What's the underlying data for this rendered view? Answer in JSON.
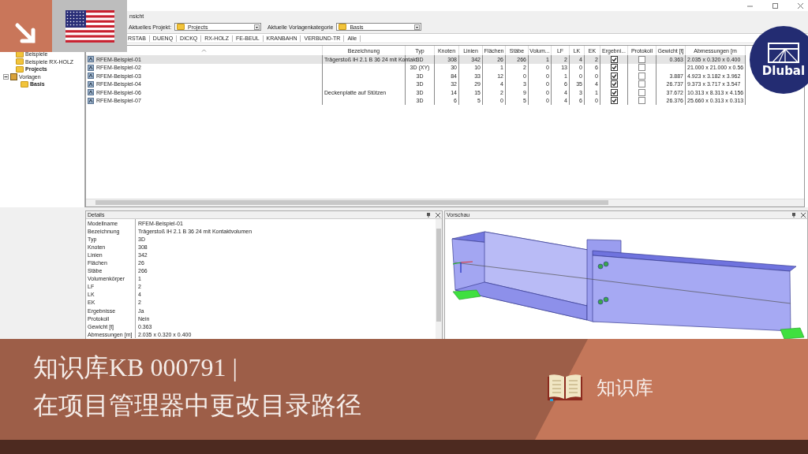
{
  "window": {
    "header_fragment": "nsicht"
  },
  "toolbar": {
    "project_label": "Aktuelles Projekt:",
    "project_value": "Projects",
    "category_label": "Aktuelle Vorlagenkategorie",
    "category_value": "Basis"
  },
  "program_tabs": [
    "RSTAB",
    "DUENQ",
    "DICKQ",
    "RX-HOLZ",
    "FE-BEUL",
    "KRANBAHN",
    "VERBUND-TR",
    "Alle"
  ],
  "tree": [
    {
      "label": "Beispiele",
      "kind": "folder",
      "current": false
    },
    {
      "label": "Beispiele RX-HOLZ",
      "kind": "folder",
      "current": false
    },
    {
      "label": "Projects",
      "kind": "folder",
      "current": true
    },
    {
      "label": "Vorlagen",
      "kind": "root",
      "current": false,
      "expanded": true,
      "children": [
        {
          "label": "Basis",
          "current": true
        }
      ]
    }
  ],
  "table": {
    "columns": [
      "Bezeichnung",
      "Typ",
      "Knoten",
      "Linien",
      "Flächen",
      "Stäbe",
      "Volum...",
      "LF",
      "LK",
      "EK",
      "Ergebni...",
      "Protokoll",
      "Gewicht [t]",
      "Abmessungen [m"
    ],
    "rows": [
      {
        "name": "RFEM-Beispiel-01",
        "description": "Trägerstoß IH 2.1 B 36 24 mit Kontakt",
        "type": "3D",
        "nodes": "308",
        "lines": "342",
        "surfaces": "26",
        "members": "266",
        "solids": "1",
        "lf": "2",
        "lk": "4",
        "ek": "2",
        "results": true,
        "report": false,
        "weight": "0.363",
        "dimensions": "2.035 x 0.320 x 0.400",
        "selected": true
      },
      {
        "name": "RFEM-Beispiel-02",
        "type": "3D (XY)",
        "nodes": "30",
        "lines": "10",
        "surfaces": "1",
        "members": "2",
        "solids": "0",
        "lf": "13",
        "lk": "0",
        "ek": "6",
        "results": true,
        "report": false,
        "dimensions": "21.000 x 21.000 x 0.56",
        "selected": false
      },
      {
        "name": "RFEM-Beispiel-03",
        "type": "3D",
        "nodes": "84",
        "lines": "33",
        "surfaces": "12",
        "members": "0",
        "solids": "0",
        "lf": "1",
        "lk": "0",
        "ek": "0",
        "results": true,
        "report": false,
        "weight": "3.887",
        "dimensions": "4.923 x 3.182 x 3.962",
        "selected": false
      },
      {
        "name": "RFEM-Beispiel-04",
        "type": "3D",
        "nodes": "32",
        "lines": "29",
        "surfaces": "4",
        "members": "3",
        "solids": "0",
        "lf": "6",
        "lk": "35",
        "ek": "4",
        "results": true,
        "report": false,
        "weight": "26.737",
        "dimensions": "9.373 x 3.717 x 3.547",
        "selected": false
      },
      {
        "name": "RFEM-Beispiel-06",
        "description": "Deckenplatte auf Stützen",
        "type": "3D",
        "nodes": "14",
        "lines": "15",
        "surfaces": "2",
        "members": "9",
        "solids": "0",
        "lf": "4",
        "lk": "3",
        "ek": "1",
        "results": true,
        "report": false,
        "weight": "37.672",
        "dimensions": "10.313 x 8.313 x 4.156",
        "selected": false
      },
      {
        "name": "RFEM-Beispiel-07",
        "type": "3D",
        "nodes": "6",
        "lines": "5",
        "surfaces": "0",
        "members": "5",
        "solids": "0",
        "lf": "4",
        "lk": "6",
        "ek": "0",
        "results": true,
        "report": false,
        "weight": "26.376",
        "dimensions": "25.660 x 0.313 x 0.313",
        "selected": false
      }
    ]
  },
  "details": {
    "title": "Details",
    "rows": [
      {
        "label": "Modellname",
        "value": "RFEM-Beispiel-01"
      },
      {
        "label": "Bezeichnung",
        "value": "Trägerstoß IH 2.1 B 36 24 mit Kontaktvolumen"
      },
      {
        "label": "Typ",
        "value": "3D"
      },
      {
        "label": "Knoten",
        "value": "308"
      },
      {
        "label": "Linien",
        "value": "342"
      },
      {
        "label": "Flächen",
        "value": "26"
      },
      {
        "label": "Stäbe",
        "value": "266"
      },
      {
        "label": "Volumenkörper",
        "value": "1"
      },
      {
        "label": "LF",
        "value": "2"
      },
      {
        "label": "LK",
        "value": "4"
      },
      {
        "label": "EK",
        "value": "2"
      },
      {
        "label": "Ergebnisse",
        "value": "Ja"
      },
      {
        "label": "Protokoll",
        "value": "Nein"
      },
      {
        "label": "Gewicht [t]",
        "value": "0.363"
      },
      {
        "label": "Abmessungen [m]",
        "value": "2.035 x 0.320 x 0.400"
      }
    ]
  },
  "preview": {
    "title": "Vorschau"
  },
  "logo": {
    "text": "Dlubal"
  },
  "banner": {
    "title_line_1": "知识库KB 000791 |",
    "title_line_2": "在项目管理器中更改目录路径",
    "section": "知识库"
  }
}
